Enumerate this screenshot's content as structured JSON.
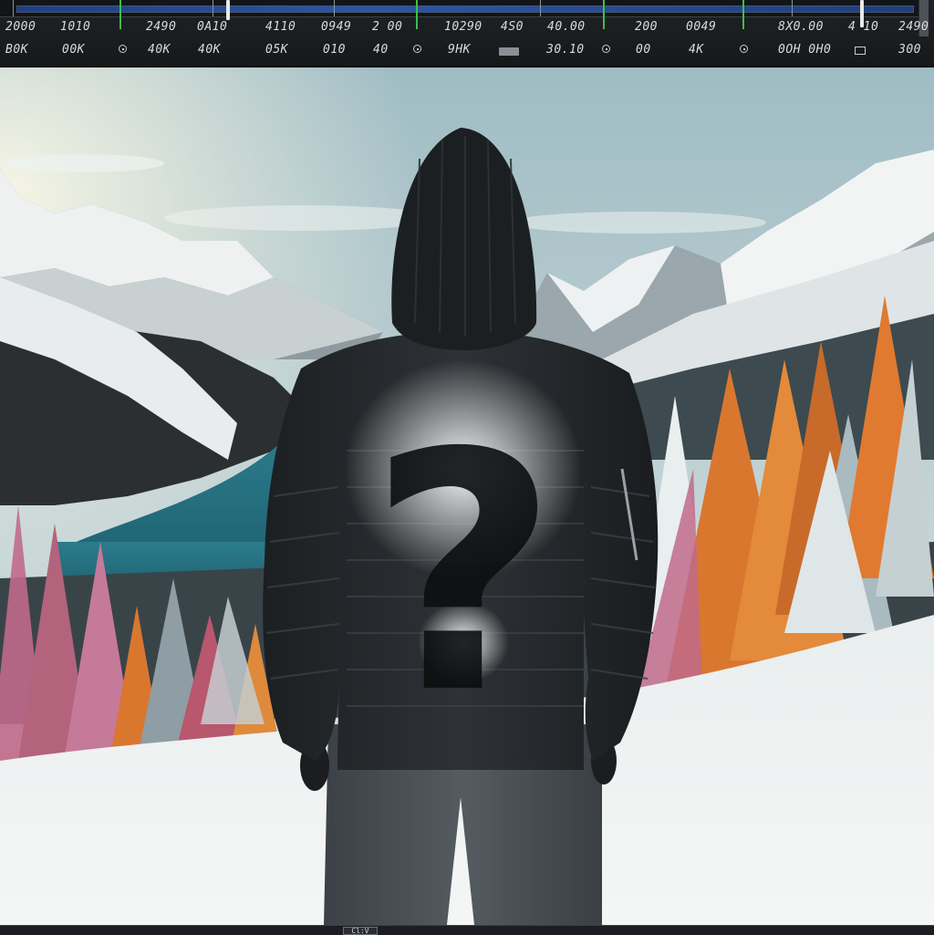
{
  "toolbar": {
    "top_row": [
      "2000",
      "1010",
      "2490",
      "0A10",
      "4110",
      "0949",
      "2 00",
      "10290",
      "4S0",
      "40.00",
      "200",
      "0049",
      "8X0.00",
      "4 10",
      "2490"
    ],
    "bottom_row": [
      "B0K",
      "00K",
      "40K",
      "40K",
      "05K",
      "010",
      "40",
      "9HK",
      "30.10",
      "00",
      "4K",
      "0OH 0H0",
      "300"
    ]
  },
  "viewport": {
    "subject": "hooded-figure",
    "overlay_glyph": "?"
  },
  "status": {
    "handle_label": "Cl:V"
  },
  "colors": {
    "timeline_track": "#2a56a8",
    "marker": "#3fbf4a",
    "lake": "#2f7d8c",
    "jacket": "#23262a",
    "foliage_orange": "#d9772f",
    "foliage_pink": "#c06a8a"
  }
}
